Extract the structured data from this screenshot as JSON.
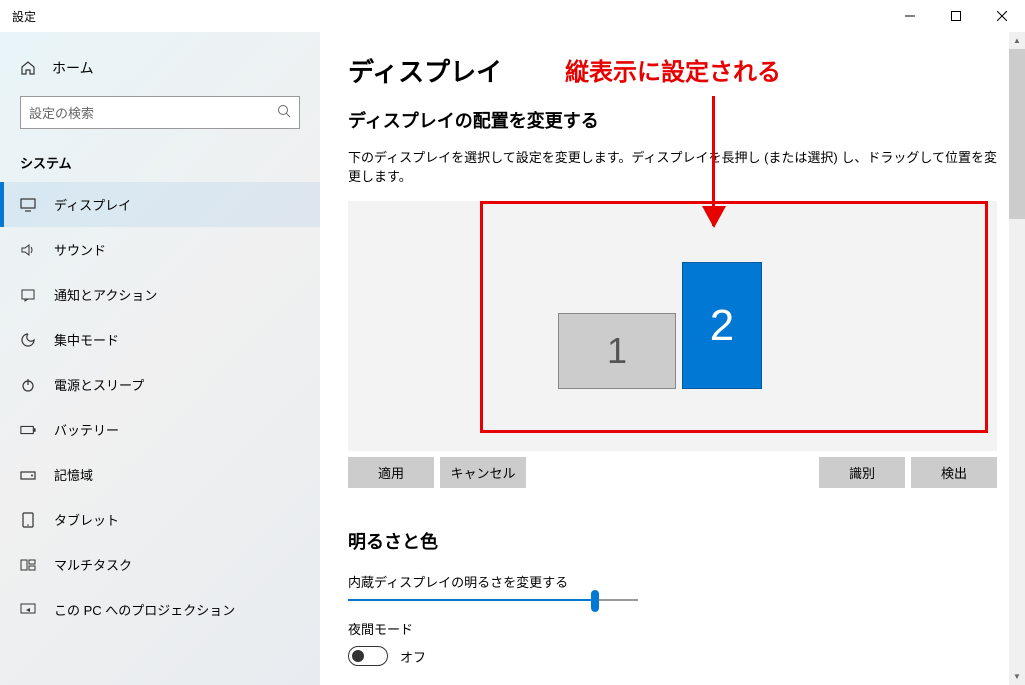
{
  "window": {
    "title": "設定"
  },
  "sidebar": {
    "home": "ホーム",
    "search_placeholder": "設定の検索",
    "group": "システム",
    "items": [
      {
        "label": "ディスプレイ"
      },
      {
        "label": "サウンド"
      },
      {
        "label": "通知とアクション"
      },
      {
        "label": "集中モード"
      },
      {
        "label": "電源とスリープ"
      },
      {
        "label": "バッテリー"
      },
      {
        "label": "記憶域"
      },
      {
        "label": "タブレット"
      },
      {
        "label": "マルチタスク"
      },
      {
        "label": "この PC へのプロジェクション"
      }
    ]
  },
  "content": {
    "title": "ディスプレイ",
    "arrange_title": "ディスプレイの配置を変更する",
    "arrange_desc": "下のディスプレイを選択して設定を変更します。ディスプレイを長押し (または選択) し、ドラッグして位置を変更します。",
    "monitor1": "1",
    "monitor2": "2",
    "apply": "適用",
    "cancel": "キャンセル",
    "identify": "識別",
    "detect": "検出",
    "brightness_title": "明るさと色",
    "brightness_label": "内蔵ディスプレイの明るさを変更する",
    "night_label": "夜間モード",
    "night_state": "オフ"
  },
  "annotation": {
    "text": "縦表示に設定される"
  }
}
